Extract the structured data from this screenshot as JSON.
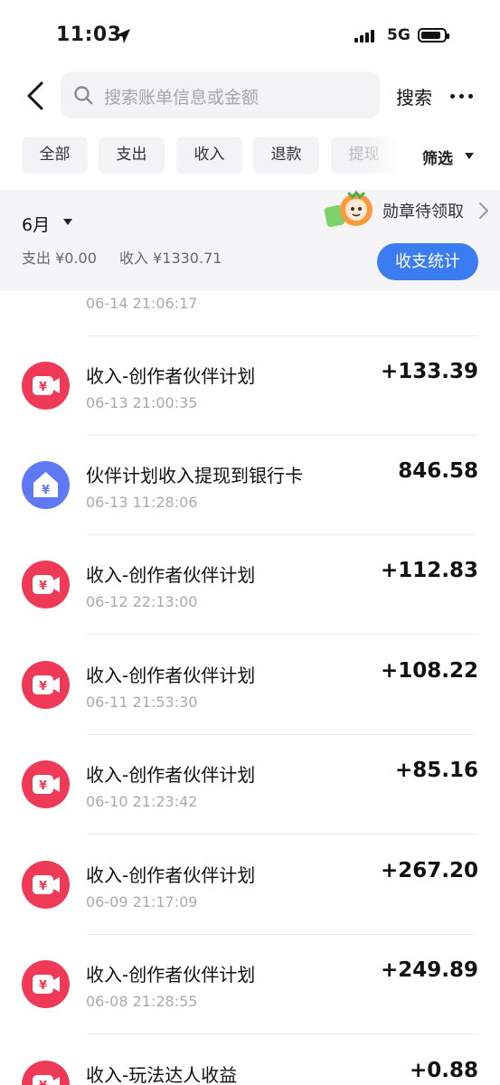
{
  "status_bar": {
    "time": "11:03",
    "network": "5G"
  },
  "search": {
    "placeholder": "搜索账单信息或金额",
    "button_label": "搜索"
  },
  "tabs": [
    {
      "label": "全部"
    },
    {
      "label": "支出"
    },
    {
      "label": "收入"
    },
    {
      "label": "退款"
    },
    {
      "label": "提现"
    }
  ],
  "filter_label": "筛选",
  "summary": {
    "month": "6月",
    "expense": "支出 ¥0.00",
    "income": "收入 ¥1330.71",
    "badge_label": "勋章待领取",
    "stats_button": "收支统计"
  },
  "transactions": [
    {
      "title": "",
      "datetime": "06-14 21:06:17",
      "amount": "",
      "icon": "video-yuan-icon",
      "color": "#ef3a57"
    },
    {
      "title": "收入-创作者伙伴计划",
      "datetime": "06-13 21:00:35",
      "amount": "+133.39",
      "icon": "video-yuan-icon",
      "color": "#ef3a57"
    },
    {
      "title": "伙伴计划收入提现到银行卡",
      "datetime": "06-13 11:28:06",
      "amount": "846.58",
      "icon": "bank-house-icon",
      "color": "#5f78f3"
    },
    {
      "title": "收入-创作者伙伴计划",
      "datetime": "06-12 22:13:00",
      "amount": "+112.83",
      "icon": "video-yuan-icon",
      "color": "#ef3a57"
    },
    {
      "title": "收入-创作者伙伴计划",
      "datetime": "06-11 21:53:30",
      "amount": "+108.22",
      "icon": "video-yuan-icon",
      "color": "#ef3a57"
    },
    {
      "title": "收入-创作者伙伴计划",
      "datetime": "06-10 21:23:42",
      "amount": "+85.16",
      "icon": "video-yuan-icon",
      "color": "#ef3a57"
    },
    {
      "title": "收入-创作者伙伴计划",
      "datetime": "06-09 21:17:09",
      "amount": "+267.20",
      "icon": "video-yuan-icon",
      "color": "#ef3a57"
    },
    {
      "title": "收入-创作者伙伴计划",
      "datetime": "06-08 21:28:55",
      "amount": "+249.89",
      "icon": "video-yuan-icon",
      "color": "#ef3a57"
    },
    {
      "title": "收入-玩法达人收益",
      "datetime": "",
      "amount": "+0.88",
      "icon": "video-yuan-icon",
      "color": "#ef3a57"
    }
  ],
  "colors": {
    "accent": "#3b7cf0",
    "income_icon": "#ef3a57",
    "withdraw_icon": "#5f78f3"
  }
}
